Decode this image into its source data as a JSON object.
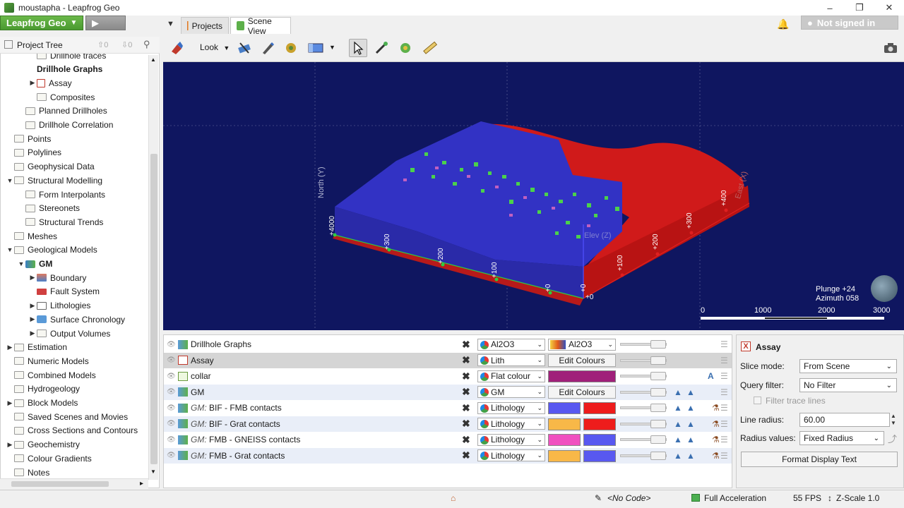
{
  "window": {
    "title": "moustapha - Leapfrog Geo"
  },
  "brand": {
    "label": "Leapfrog Geo"
  },
  "tabs": [
    {
      "label": "Projects"
    },
    {
      "label": "Scene View"
    }
  ],
  "account": {
    "signin_label": "Not signed in"
  },
  "tree": {
    "title": "Project Tree",
    "up_count": "0",
    "down_count": "0",
    "items": [
      {
        "label": "Drillhole traces"
      },
      {
        "label": "Drillhole Graphs"
      },
      {
        "label": "Assay"
      },
      {
        "label": "Composites"
      },
      {
        "label": "Planned Drillholes"
      },
      {
        "label": "Drillhole Correlation"
      },
      {
        "label": "Points"
      },
      {
        "label": "Polylines"
      },
      {
        "label": "Geophysical Data"
      },
      {
        "label": "Structural Modelling"
      },
      {
        "label": "Form Interpolants"
      },
      {
        "label": "Stereonets"
      },
      {
        "label": "Structural Trends"
      },
      {
        "label": "Meshes"
      },
      {
        "label": "Geological Models"
      },
      {
        "label": "GM"
      },
      {
        "label": "Boundary"
      },
      {
        "label": "Fault System"
      },
      {
        "label": "Lithologies"
      },
      {
        "label": "Surface Chronology"
      },
      {
        "label": "Output Volumes"
      },
      {
        "label": "Estimation"
      },
      {
        "label": "Numeric Models"
      },
      {
        "label": "Combined Models"
      },
      {
        "label": "Hydrogeology"
      },
      {
        "label": "Block Models"
      },
      {
        "label": "Saved Scenes and Movies"
      },
      {
        "label": "Cross Sections and Contours"
      },
      {
        "label": "Geochemistry"
      },
      {
        "label": "Colour Gradients"
      },
      {
        "label": "Notes"
      }
    ]
  },
  "toolbar": {
    "look_label": "Look"
  },
  "viewport": {
    "axis_north": "North (Y)",
    "axis_east": "East (X)",
    "axis_elev": "Elev (Z)",
    "north_ticks": [
      "+4000",
      "+300",
      "+200",
      "+100",
      "+0"
    ],
    "east_ticks": [
      "+0",
      "+100",
      "+200",
      "+300",
      "+400"
    ],
    "elev_tick": "+0",
    "plunge": "Plunge +24",
    "azimuth": "Azimuth 058",
    "scale_ticks": [
      "0",
      "1000",
      "2000",
      "3000"
    ]
  },
  "layers": [
    {
      "prefix": "",
      "name": "Drillhole Graphs",
      "combo": "Al2O3",
      "right": "Al2O3",
      "kind": "gradient"
    },
    {
      "prefix": "",
      "name": "Assay",
      "combo": "Lith",
      "right": "Edit Colours",
      "kind": "edit"
    },
    {
      "prefix": "",
      "name": "collar",
      "combo": "Flat colour",
      "right": "",
      "kind": "flat"
    },
    {
      "prefix": "",
      "name": "GM",
      "combo": "GM",
      "right": "Edit Colours",
      "kind": "edit"
    },
    {
      "prefix": "GM:",
      "name": " BIF - FMB contacts",
      "combo": "Lithology",
      "kind": "pair"
    },
    {
      "prefix": "GM:",
      "name": " BIF - Grat contacts",
      "combo": "Lithology",
      "kind": "pair"
    },
    {
      "prefix": "GM:",
      "name": " FMB - GNEISS contacts",
      "combo": "Lithology",
      "kind": "pair"
    },
    {
      "prefix": "GM:",
      "name": " FMB - Grat contacts",
      "combo": "Lithology",
      "kind": "pair"
    }
  ],
  "colors": {
    "blue": "#5858f0",
    "red": "#ee1c1c",
    "orange": "#f8b848",
    "pink": "#f050c0",
    "magenta": "#a0207a"
  },
  "props": {
    "title": "Assay",
    "slice_mode_label": "Slice mode:",
    "slice_mode_value": "From Scene",
    "query_filter_label": "Query filter:",
    "query_filter_value": "No Filter",
    "filter_trace_label": "Filter trace lines",
    "line_radius_label": "Line radius:",
    "line_radius_value": "60.00",
    "radius_values_label": "Radius values:",
    "radius_values_value": "Fixed Radius",
    "format_button": "Format Display Text"
  },
  "status": {
    "code": "<No Code>",
    "accel": "Full Acceleration",
    "fps": "55 FPS",
    "zscale": "Z-Scale 1.0"
  }
}
